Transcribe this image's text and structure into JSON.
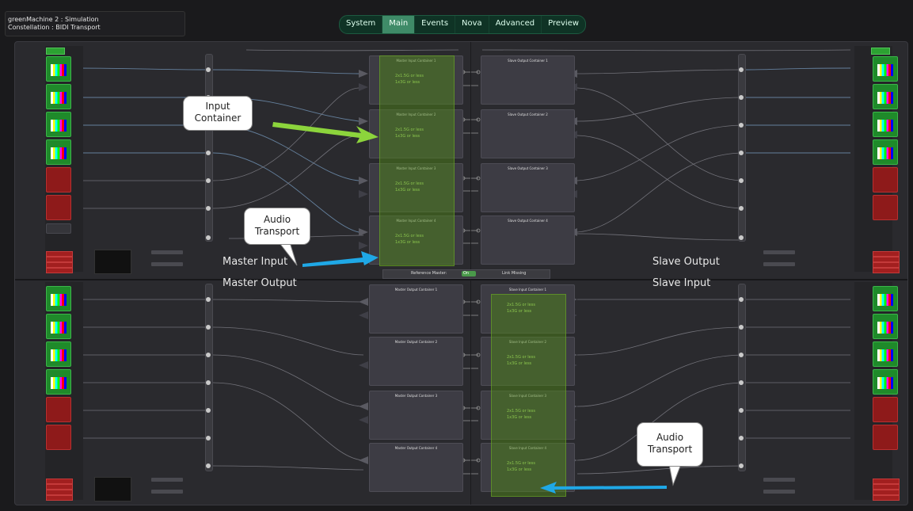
{
  "window": {
    "line1": "greenMachine 2 : Simulation",
    "line2": "Constellation : BIDI Transport"
  },
  "tabs": [
    {
      "label": "System"
    },
    {
      "label": "Main",
      "active": true
    },
    {
      "label": "Events"
    },
    {
      "label": "Nova"
    },
    {
      "label": "Advanced"
    },
    {
      "label": "Preview"
    }
  ],
  "sections": {
    "master_input": "Master Input",
    "master_output": "Master Output",
    "slave_output": "Slave Output",
    "slave_input": "Slave Input"
  },
  "containers": {
    "master_input": [
      "Master Input Container 1",
      "Master Input Container 2",
      "Master Input Container 3",
      "Master Input Container 4"
    ],
    "slave_output": [
      "Slave Output Container 1",
      "Slave Output Container 2",
      "Slave Output Container 3",
      "Slave Output Container 4"
    ],
    "master_output": [
      "Master Output Container 1",
      "Master Output Container 2",
      "Master Output Container 3",
      "Master Output Container 4"
    ],
    "slave_input": [
      "Slave Input Container 1",
      "Slave Input Container 2",
      "Slave Input Container 3",
      "Slave Input Container 4"
    ]
  },
  "options": {
    "opt1": "2x1.5G or less",
    "opt2": "1x3G or less"
  },
  "reference": {
    "label": "Reference Master:",
    "toggle_label": "On",
    "status": "Link Missing"
  },
  "callouts": {
    "input_container": [
      "Input",
      "Container"
    ],
    "audio_transport_top": [
      "Audio",
      "Transport"
    ],
    "audio_transport_bottom": [
      "Audio",
      "Transport"
    ]
  },
  "colors": {
    "accent_green": "#3f8b68",
    "source_green": "#1f8a2a",
    "source_red": "#8e1a1a",
    "arrow_green": "#8cd43c",
    "arrow_blue": "#1fa8e6"
  }
}
